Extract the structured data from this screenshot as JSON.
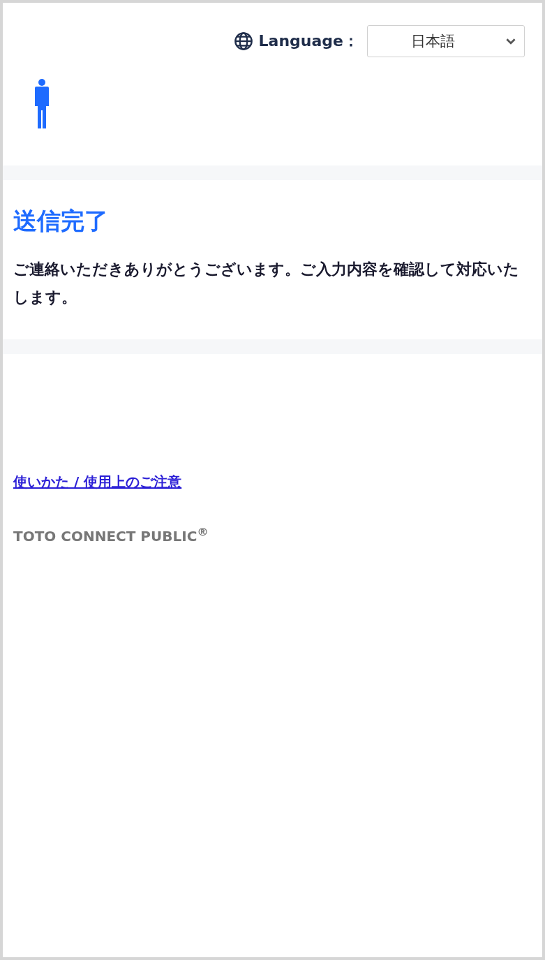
{
  "header": {
    "language_label": "Language：",
    "language_select": {
      "value": "日本語"
    }
  },
  "result": {
    "title": "送信完了",
    "message": "ご連絡いただきありがとうございます。ご入力内容を確認して対応いたします。"
  },
  "footer": {
    "link": "使いかた / 使用上のご注意",
    "brand": "TOTO CONNECT PUBLIC$^{®}$"
  }
}
